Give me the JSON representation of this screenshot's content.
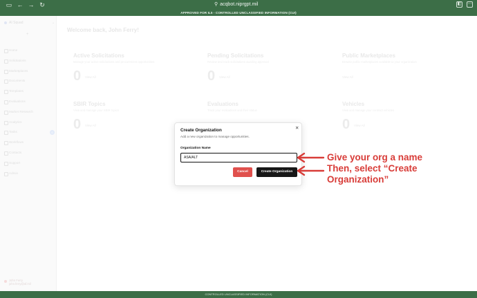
{
  "browser": {
    "url": "acqbot.niprgpt.mil",
    "banner": "APPROVED FOR IL5 - CONTROLLED UNCLASSIFIED INFORMATION (CUI)",
    "icons": [
      "sidebar-toggle-icon",
      "back-icon",
      "forward-icon",
      "reload-icon",
      "lock-icon",
      "extension-icon",
      "menu-icon"
    ]
  },
  "background": {
    "welcome": "Welcome back, John Ferry!",
    "sidebar": {
      "org": "AI Squad",
      "items": [
        "Home",
        "Solicitations",
        "Marketplaces",
        "Documents",
        "Templates",
        "Evaluations",
        "Market Research",
        "Analytics",
        "Tasks",
        "Workflows",
        "Contacts",
        "Support",
        "Admin"
      ],
      "tasks_badge": "0",
      "user_name": "John Ferry",
      "user_email": "john.ferry@af.mil"
    },
    "cards": [
      {
        "title": "Active Solicitations",
        "desc": "Manage your active solicitations and procurement opportunities",
        "count": "0",
        "link": "View All"
      },
      {
        "title": "Pending Solicitations",
        "desc": "Review and track solicitations awaiting approval",
        "count": "0",
        "link": "View All"
      },
      {
        "title": "Public Marketplaces",
        "desc": "Browse public marketplaces available to your organization",
        "count": "",
        "link": "View All"
      },
      {
        "title": "SBIR Topics",
        "desc": "View and manage your SBIR topics",
        "count": "0",
        "link": "View All"
      },
      {
        "title": "Evaluations",
        "desc": "Track your evaluations and their status",
        "count": "",
        "link": ""
      },
      {
        "title": "Vehicles",
        "desc": "View and manage your contract vehicles",
        "count": "0",
        "link": "View All"
      }
    ],
    "footer": "CONTROLLED UNCLASSIFIED INFORMATION (CUI)"
  },
  "modal": {
    "title": "Create Organization",
    "description": "Add a new organization to manage opportunities.",
    "field_label": "Organization Name",
    "field_value": "ASA/ALT",
    "cancel_label": "Cancel",
    "create_label": "Create Organization",
    "close_icon": "close-icon"
  },
  "annotation": {
    "line1": "Give your org a name",
    "line2": "Then, select “Create",
    "line3": "Organization”",
    "color": "#d83c38"
  },
  "colors": {
    "chrome": "#3c6e47",
    "cancel": "#e0504d",
    "create": "#171717"
  }
}
